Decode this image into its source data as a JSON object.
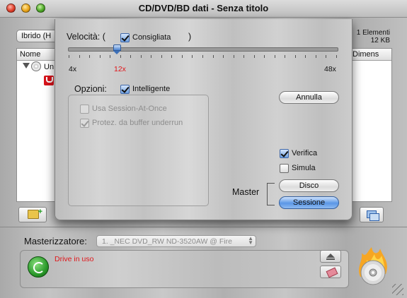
{
  "window": {
    "title": "CD/DVD/BD dati - Senza titolo"
  },
  "toolbar": {
    "mode_popup": "Ibrido (H",
    "element_count": "1 Elementi",
    "size": "12 KB"
  },
  "file_list": {
    "columns": [
      "Nome",
      "Dimens"
    ],
    "root_item": "Un"
  },
  "sheet": {
    "speed_label": "Velocità: (",
    "speed_paren_close": ")",
    "recommended_label": "Consigliata",
    "recommended_checked": true,
    "speed_min": "4x",
    "speed_selected": "12x",
    "speed_max": "48x",
    "speed_selected_fraction": 0.18,
    "options_label": "Opzioni:",
    "smart_label": "Intelligente",
    "smart_checked": true,
    "options": [
      {
        "label": "Usa Session-At-Once",
        "checked": false,
        "enabled": false
      },
      {
        "label": "Protez. da buffer underrun",
        "checked": true,
        "enabled": false
      }
    ],
    "cancel_button": "Annulla",
    "verify_label": "Verifica",
    "verify_checked": true,
    "simulate_label": "Simula",
    "simulate_checked": false,
    "master_label": "Master",
    "disc_button": "Disco",
    "session_button": "Sessione"
  },
  "burner": {
    "label": "Masterizzatore:",
    "selected": "1. _NEC DVD_RW ND-3520AW @ Fire"
  },
  "status": {
    "drive_status": "Drive in uso"
  },
  "colors": {
    "accent_blue": "#5b97e6",
    "status_red": "#e0161a"
  }
}
